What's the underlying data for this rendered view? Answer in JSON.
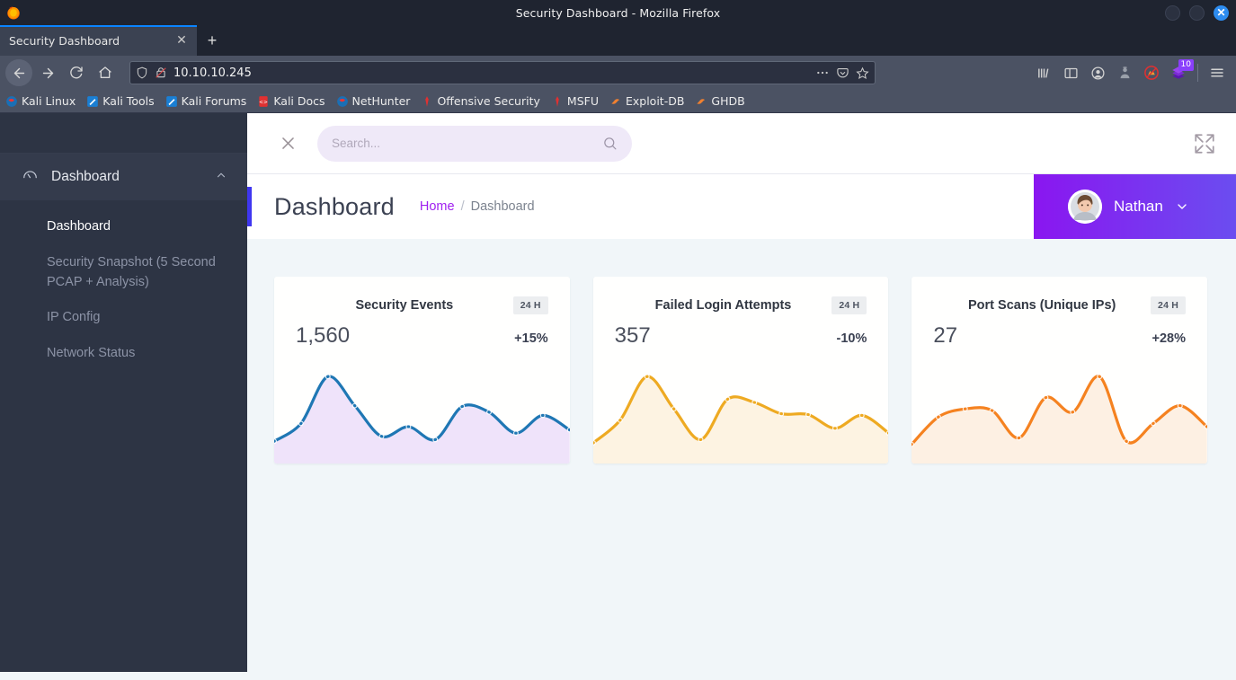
{
  "browser": {
    "window_title": "Security Dashboard - Mozilla Firefox",
    "tab_label": "Security Dashboard",
    "tab_close_glyph": "✕",
    "new_tab_glyph": "+",
    "window_close_glyph": "✕",
    "url": "10.10.10.245",
    "extension_badge_count": "10",
    "bookmarks": [
      {
        "label": "Kali Linux",
        "icon": "kali-dragon-icon"
      },
      {
        "label": "Kali Tools",
        "icon": "kali-tools-icon"
      },
      {
        "label": "Kali Forums",
        "icon": "kali-forums-icon"
      },
      {
        "label": "Kali Docs",
        "icon": "kali-docs-icon"
      },
      {
        "label": "NetHunter",
        "icon": "nethunter-icon"
      },
      {
        "label": "Offensive Security",
        "icon": "offensive-security-icon"
      },
      {
        "label": "MSFU",
        "icon": "msfu-icon"
      },
      {
        "label": "Exploit-DB",
        "icon": "exploit-db-icon"
      },
      {
        "label": "GHDB",
        "icon": "ghdb-icon"
      }
    ]
  },
  "sidebar": {
    "group": {
      "label": "Dashboard",
      "icon": "speedometer-icon",
      "chevron": "chevron-up-icon"
    },
    "items": [
      {
        "label": "Dashboard",
        "active": true
      },
      {
        "label": "Security Snapshot (5 Second PCAP + Analysis)",
        "active": false
      },
      {
        "label": "IP Config",
        "active": false
      },
      {
        "label": "Network Status",
        "active": false
      }
    ]
  },
  "header": {
    "close_icon": "close-icon",
    "expand_icon": "expand-icon",
    "search": {
      "value": "",
      "placeholder": "Search...",
      "icon": "search-icon"
    }
  },
  "title_bar": {
    "title": "Dashboard",
    "breadcrumb": {
      "home": "Home",
      "separator": "/",
      "current": "Dashboard"
    },
    "user": {
      "name": "Nathan",
      "chevron": "chevron-down-icon",
      "avatar": "user-avatar"
    },
    "accent_color": "#3f36f0",
    "user_gradient_from": "#8a16f0",
    "user_gradient_to": "#6b4df0"
  },
  "cards": [
    {
      "title": "Security Events",
      "badge": "24 H",
      "value": "1,560",
      "delta": "+15%",
      "line_color": "#1f77b4",
      "fill_color": "#efe3fa"
    },
    {
      "title": "Failed Login Attempts",
      "badge": "24 H",
      "value": "357",
      "delta": "-10%",
      "line_color": "#eeaa22",
      "fill_color": "#fdf3e2"
    },
    {
      "title": "Port Scans (Unique IPs)",
      "badge": "24 H",
      "value": "27",
      "delta": "+28%",
      "line_color": "#f58220",
      "fill_color": "#fdf0e3"
    }
  ],
  "chart_data": [
    {
      "type": "area",
      "title": "Security Events",
      "series": [
        {
          "name": "Security Events",
          "color": "#1f77b4",
          "values": [
            12,
            34,
            92,
            56,
            18,
            30,
            14,
            55,
            48,
            22,
            44,
            26
          ]
        }
      ],
      "x": [
        0,
        1,
        2,
        3,
        4,
        5,
        6,
        7,
        8,
        9,
        10,
        11
      ],
      "xlabel": "",
      "ylabel": "",
      "ylim": [
        0,
        100
      ],
      "grid": false,
      "legend": "none",
      "markers": true
    },
    {
      "type": "area",
      "title": "Failed Login Attempts",
      "series": [
        {
          "name": "Failed Login Attempts",
          "color": "#eeaa22",
          "values": [
            10,
            38,
            92,
            52,
            14,
            64,
            60,
            46,
            45,
            28,
            44,
            22
          ]
        }
      ],
      "x": [
        0,
        1,
        2,
        3,
        4,
        5,
        6,
        7,
        8,
        9,
        10,
        11
      ],
      "xlabel": "",
      "ylabel": "",
      "ylim": [
        0,
        100
      ],
      "grid": false,
      "legend": "none",
      "markers": true
    },
    {
      "type": "area",
      "title": "Port Scans (Unique IPs)",
      "series": [
        {
          "name": "Port Scans (Unique IPs)",
          "color": "#f58220",
          "values": [
            8,
            42,
            52,
            50,
            16,
            66,
            48,
            92,
            12,
            34,
            56,
            30
          ]
        }
      ],
      "x": [
        0,
        1,
        2,
        3,
        4,
        5,
        6,
        7,
        8,
        9,
        10,
        11
      ],
      "xlabel": "",
      "ylabel": "",
      "ylim": [
        0,
        100
      ],
      "grid": false,
      "legend": "none",
      "markers": true
    }
  ]
}
